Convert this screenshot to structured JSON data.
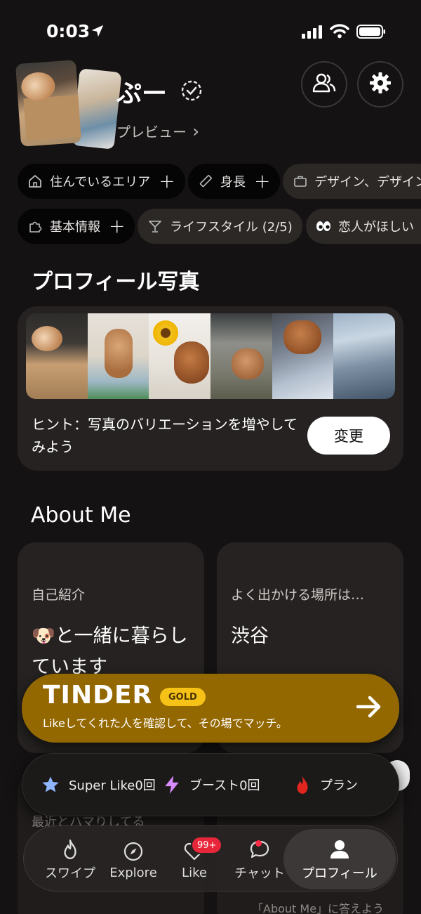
{
  "status_bar": {
    "time": "0:03"
  },
  "profile": {
    "name": "ぷー",
    "preview_label": "プレビュー",
    "preview_chevron": "›"
  },
  "chips_row1": [
    {
      "icon": "home-icon",
      "label": "住んでいるエリア",
      "plus": "+"
    },
    {
      "icon": "ruler-icon",
      "label": "身長",
      "plus": "+"
    },
    {
      "icon": "briefcase-icon",
      "label": "デザイン、デザイン"
    }
  ],
  "chips_row2": [
    {
      "icon": "puzzle-icon",
      "label": "基本情報",
      "plus": "+"
    },
    {
      "icon": "cocktail-icon",
      "label": "ライフスタイル (2/5)"
    },
    {
      "icon": "eyes-icon",
      "label": "恋人がほしい"
    }
  ],
  "photos_section": {
    "title": "プロフィール写真",
    "hint": "ヒント：写真のバリエーションを増やしてみよう",
    "change_button": "変更"
  },
  "about_section": {
    "title": "About Me",
    "cards": [
      {
        "label": "自己紹介",
        "value": "🐶と一緒に暮らしています"
      },
      {
        "label": "よく出かける場所は…",
        "value": "渋谷"
      }
    ],
    "card3_label": "最近とハマりしてる",
    "card4_label": "「About Me」に答えよう"
  },
  "gold_banner": {
    "brand": "TINDER",
    "tier": "GOLD",
    "subtitle": "Likeしてくれた人を確認して、その場でマッチ。",
    "colors": {
      "background": "#946800",
      "tier_badge": "#f6c218"
    }
  },
  "quick_bar": [
    {
      "icon": "star-icon",
      "label": "Super Like0回"
    },
    {
      "icon": "bolt-icon",
      "label": "ブースト0回"
    },
    {
      "icon": "flame-icon",
      "label": "プラン"
    }
  ],
  "nav": {
    "items": [
      {
        "icon": "flame-icon",
        "label": "スワイプ"
      },
      {
        "icon": "compass-icon",
        "label": "Explore"
      },
      {
        "icon": "heart-icon",
        "label": "Like",
        "badge": "99+"
      },
      {
        "icon": "chat-icon",
        "label": "チャット"
      },
      {
        "icon": "person-icon",
        "label": "プロフィール",
        "active": true
      }
    ]
  }
}
